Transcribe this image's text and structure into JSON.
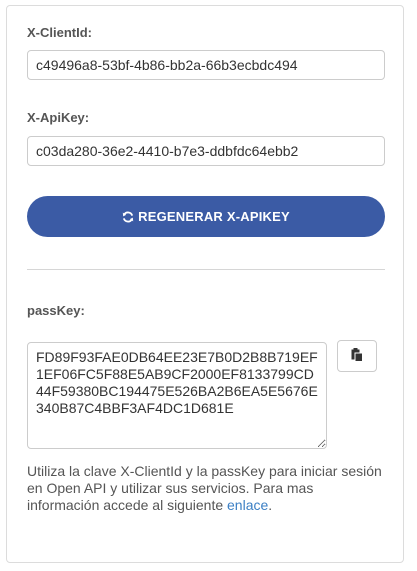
{
  "client_id": {
    "label": "X-ClientId:",
    "value": "c49496a8-53bf-4b86-bb2a-66b3ecbdc494"
  },
  "api_key": {
    "label": "X-ApiKey:",
    "value": "c03da280-36e2-4410-b7e3-ddbfdc64ebb2"
  },
  "regenerate_button": {
    "label": "REGENERAR X-APIKEY",
    "icon": "refresh-icon"
  },
  "pass_key": {
    "label": "passKey:",
    "value": "FD89F93FAE0DB64EE23E7B0D2B8B719EF1EF06FC5F88E5AB9CF2000EF8133799CD44F59380BC194475E526BA2B6EA5E5676E340B87C4BBF3AF4DC1D681E",
    "copy_icon": "clipboard-icon"
  },
  "info": {
    "text": "Utiliza la clave X-ClientId y la passKey para iniciar sesión en Open API y utilizar sus servicios. Para mas información accede al siguiente ",
    "link_text": "enlace",
    "suffix": "."
  },
  "colors": {
    "button_bg": "#3b5ba5",
    "link": "#3b7fc4"
  }
}
